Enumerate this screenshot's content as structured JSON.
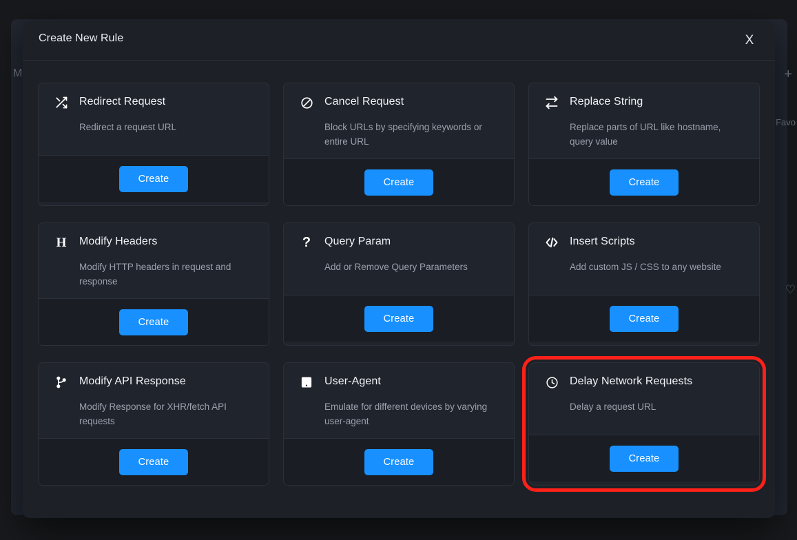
{
  "background": {
    "letter_m": "M",
    "plus_icon": "plus-icon",
    "favorites_label": "Favo",
    "heart_icon": "heart-icon"
  },
  "modal": {
    "title": "Create New Rule",
    "close_label": "X",
    "close_icon": "close-icon"
  },
  "accent_colors": {
    "primary_button": "#1890ff",
    "highlight_ring": "#fc2119",
    "card_bg": "#20242c",
    "card_footer_bg": "#1a1d23",
    "modal_bg": "#1d2127"
  },
  "cards": [
    {
      "id": "redirect-request",
      "icon": "shuffle-icon",
      "title": "Redirect Request",
      "description": "Redirect a request URL",
      "button": "Create",
      "highlighted": false
    },
    {
      "id": "cancel-request",
      "icon": "block-icon",
      "title": "Cancel Request",
      "description": "Block URLs by specifying keywords or entire URL",
      "button": "Create",
      "highlighted": false
    },
    {
      "id": "replace-string",
      "icon": "swap-arrows-icon",
      "title": "Replace String",
      "description": "Replace parts of URL like hostname, query value",
      "button": "Create",
      "highlighted": false
    },
    {
      "id": "modify-headers",
      "icon": "letter-h-icon",
      "title": "Modify Headers",
      "description": "Modify HTTP headers in request and response",
      "button": "Create",
      "highlighted": false
    },
    {
      "id": "query-param",
      "icon": "question-mark-icon",
      "title": "Query Param",
      "description": "Add or Remove Query Parameters",
      "button": "Create",
      "highlighted": false
    },
    {
      "id": "insert-scripts",
      "icon": "code-brackets-icon",
      "title": "Insert Scripts",
      "description": "Add custom JS / CSS to any website",
      "button": "Create",
      "highlighted": false
    },
    {
      "id": "modify-api-response",
      "icon": "git-branch-icon",
      "title": "Modify API Response",
      "description": "Modify Response for XHR/fetch API requests",
      "button": "Create",
      "highlighted": false
    },
    {
      "id": "user-agent",
      "icon": "device-tablet-icon",
      "title": "User-Agent",
      "description": "Emulate for different devices by varying user-agent",
      "button": "Create",
      "highlighted": false
    },
    {
      "id": "delay-network-requests",
      "icon": "clock-icon",
      "title": "Delay Network Requests",
      "description": "Delay a request URL",
      "button": "Create",
      "highlighted": true
    }
  ]
}
